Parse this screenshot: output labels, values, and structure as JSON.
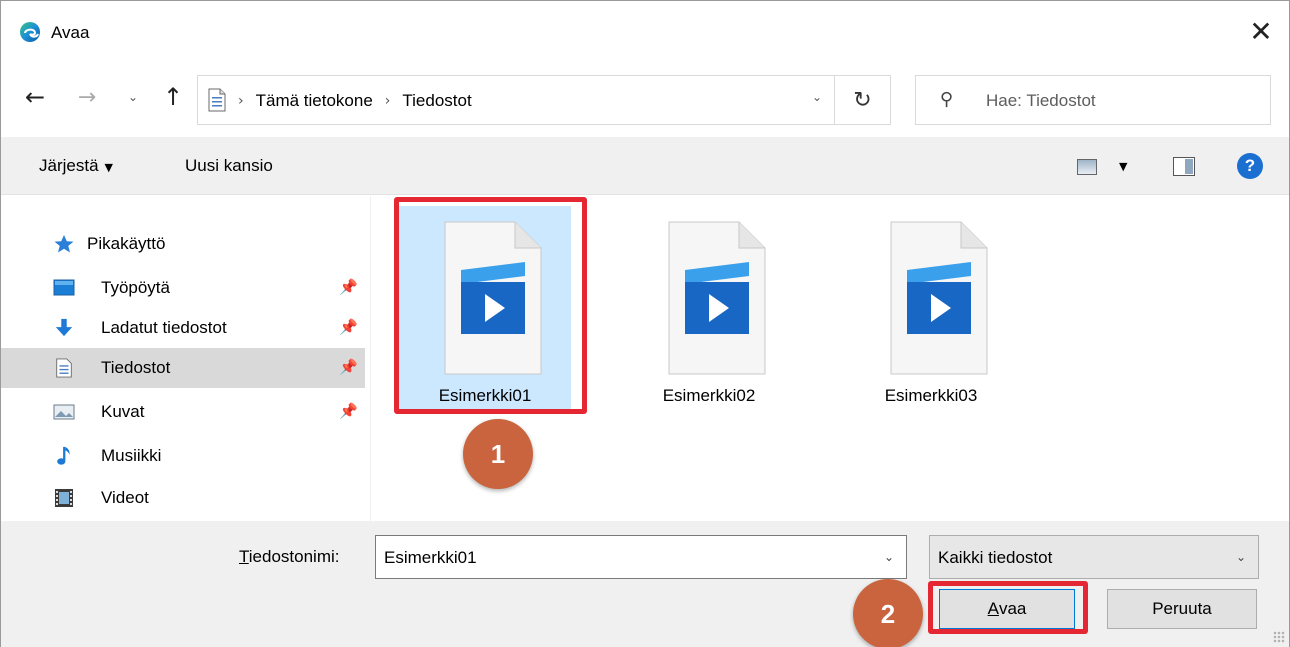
{
  "window": {
    "title": "Avaa",
    "close_glyph": "✕"
  },
  "navigation": {
    "back_glyph": "←",
    "forward_glyph": "→",
    "recent_glyph": "⌄",
    "up_glyph": "↑",
    "breadcrumb": [
      "Tämä tietokone",
      "Tiedostot"
    ],
    "breadcrumb_separator": "›",
    "dropdown_glyph": "⌄",
    "refresh_glyph": "↻"
  },
  "search": {
    "placeholder": "Hae: Tiedostot",
    "icon": "search-icon",
    "glyph": "⚲"
  },
  "toolbar": {
    "organize_label": "Järjestä",
    "organize_caret": "▼",
    "new_folder_label": "Uusi kansio",
    "view_caret": "▼",
    "help_label": "?"
  },
  "sidebar": {
    "quick_access": "Pikakäyttö",
    "pin_glyph": "📌",
    "items": [
      {
        "label": "Työpöytä",
        "icon": "desktop-icon",
        "pinned": true
      },
      {
        "label": "Ladatut tiedostot",
        "icon": "download-icon",
        "pinned": true
      },
      {
        "label": "Tiedostot",
        "icon": "documents-icon",
        "pinned": true,
        "selected": true
      },
      {
        "label": "Kuvat",
        "icon": "pictures-icon",
        "pinned": true
      },
      {
        "label": "Musiikki",
        "icon": "music-icon",
        "pinned": false
      },
      {
        "label": "Videot",
        "icon": "videos-icon",
        "pinned": false
      }
    ]
  },
  "files": [
    {
      "name": "Esimerkki01",
      "selected": true
    },
    {
      "name": "Esimerkki02",
      "selected": false
    },
    {
      "name": "Esimerkki03",
      "selected": false
    }
  ],
  "annotations": {
    "step1": "1",
    "step2": "2",
    "highlight_color": "#e52733",
    "badge_color": "#c9643f"
  },
  "bottom": {
    "filename_label_prefix": "T",
    "filename_label_rest": "iedostonimi:",
    "filename_value": "Esimerkki01",
    "filetype_value": "Kaikki tiedostot",
    "dropdown_glyph": "⌄",
    "open_prefix": "A",
    "open_rest": "vaa",
    "cancel_label": "Peruuta"
  },
  "colors": {
    "accent": "#0078d7",
    "selection": "#cce8ff",
    "sidebar_selected": "#d9d9d9",
    "toolbar_bg": "#f0f0f0"
  }
}
